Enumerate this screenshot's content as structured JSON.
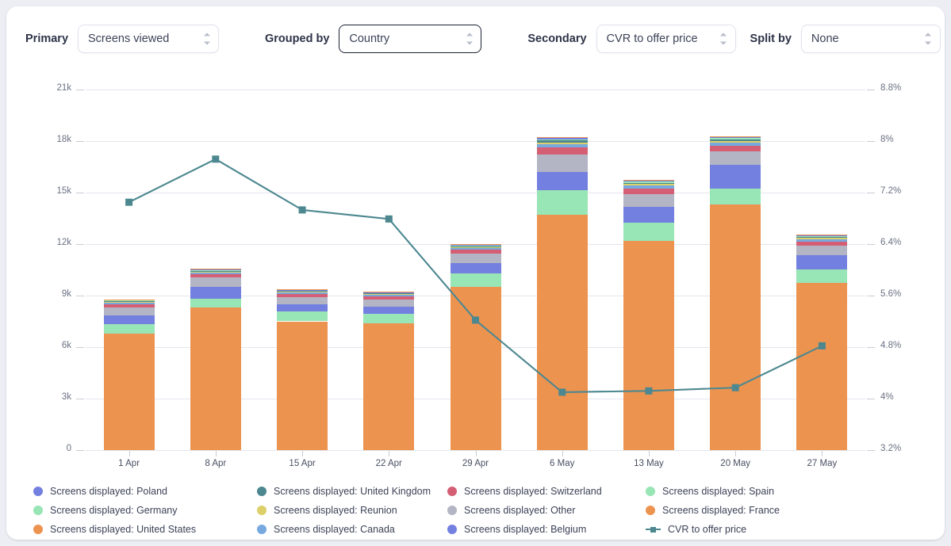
{
  "controls": [
    {
      "label": "Primary",
      "value": "Screens viewed",
      "focused": false,
      "name": "primary"
    },
    {
      "label": "Grouped by",
      "value": "Country",
      "focused": true,
      "name": "grouped-by"
    },
    {
      "label": "Secondary",
      "value": "CVR to offer price",
      "focused": false,
      "name": "secondary"
    },
    {
      "label": "Split by",
      "value": "None",
      "focused": false,
      "name": "split-by"
    }
  ],
  "chart_data": {
    "type": "bar",
    "title": "",
    "xlabel": "",
    "ylabel": "",
    "categories": [
      "1 Apr",
      "8 Apr",
      "15 Apr",
      "22 Apr",
      "29 Apr",
      "6 May",
      "13 May",
      "20 May",
      "27 May"
    ],
    "left_axis": {
      "ticks": [
        "0",
        "3k",
        "6k",
        "9k",
        "12k",
        "15k",
        "18k",
        "21k"
      ],
      "values": [
        0,
        3000,
        6000,
        9000,
        12000,
        15000,
        18000,
        21000
      ],
      "ylim": [
        0,
        21000
      ]
    },
    "right_axis": {
      "ticks": [
        "3.2%",
        "4%",
        "4.8%",
        "5.6%",
        "6.4%",
        "7.2%",
        "8%",
        "8.8%"
      ],
      "values": [
        3.2,
        4.0,
        4.8,
        5.6,
        6.4,
        7.2,
        8.0,
        8.8
      ],
      "ylim": [
        3.2,
        8.8
      ]
    },
    "grid": true,
    "legend_position": "bottom",
    "stacked": true,
    "series": [
      {
        "name": "Screens displayed: France",
        "color": "#ed9350",
        "values": [
          6800,
          8300,
          7500,
          7400,
          9500,
          13700,
          12200,
          14300,
          9750
        ]
      },
      {
        "name": "Screens displayed: Spain",
        "color": "#98e5b5",
        "values": [
          520,
          520,
          560,
          520,
          800,
          1450,
          1050,
          950,
          780
        ]
      },
      {
        "name": "Screens displayed: Belgium",
        "color": "#7380e0",
        "values": [
          540,
          700,
          420,
          430,
          600,
          1050,
          900,
          1350,
          820
        ]
      },
      {
        "name": "Screens displayed: Other",
        "color": "#b3b5c4",
        "values": [
          450,
          530,
          430,
          420,
          540,
          1000,
          760,
          800,
          560
        ]
      },
      {
        "name": "Screens displayed: Switzerland",
        "color": "#d45f74",
        "values": [
          180,
          180,
          170,
          170,
          220,
          420,
          330,
          340,
          250
        ]
      },
      {
        "name": "Screens displayed: Canada",
        "color": "#77a9de",
        "values": [
          110,
          120,
          110,
          110,
          120,
          200,
          160,
          170,
          130
        ]
      },
      {
        "name": "Screens displayed: Reunion",
        "color": "#ddd06a",
        "values": [
          45,
          50,
          45,
          45,
          50,
          110,
          90,
          95,
          60
        ]
      },
      {
        "name": "Screens displayed: United Kingdom",
        "color": "#4d8890",
        "values": [
          40,
          45,
          40,
          40,
          45,
          95,
          75,
          85,
          55
        ]
      },
      {
        "name": "Screens displayed: Germany",
        "color": "#98e5b5",
        "values": [
          35,
          40,
          35,
          35,
          40,
          85,
          65,
          75,
          50
        ]
      },
      {
        "name": "Screens displayed: Poland",
        "color": "#7380e0",
        "values": [
          30,
          35,
          30,
          30,
          35,
          75,
          55,
          65,
          45
        ]
      },
      {
        "name": "Screens displayed: United States",
        "color": "#ed9350",
        "values": [
          25,
          30,
          25,
          25,
          30,
          65,
          45,
          55,
          40
        ]
      }
    ],
    "line_series": {
      "name": "CVR to offer price",
      "color": "#4d8890",
      "values": [
        7.05,
        7.72,
        6.93,
        6.79,
        5.22,
        4.1,
        4.12,
        4.17,
        4.82
      ]
    }
  },
  "legend": [
    {
      "label": "Screens displayed: Poland",
      "color": "#7380e0",
      "marker": "dot",
      "name": "legend-poland"
    },
    {
      "label": "Screens displayed: Germany",
      "color": "#98e5b5",
      "marker": "dot",
      "name": "legend-germany"
    },
    {
      "label": "Screens displayed: United States",
      "color": "#ed9350",
      "marker": "dot",
      "name": "legend-united-states"
    },
    {
      "label": "Screens displayed: United Kingdom",
      "color": "#4d8890",
      "marker": "dot",
      "name": "legend-united-kingdom"
    },
    {
      "label": "Screens displayed: Reunion",
      "color": "#ddd06a",
      "marker": "dot",
      "name": "legend-reunion"
    },
    {
      "label": "Screens displayed: Canada",
      "color": "#77a9de",
      "marker": "dot",
      "name": "legend-canada"
    },
    {
      "label": "Screens displayed: Switzerland",
      "color": "#d45f74",
      "marker": "dot",
      "name": "legend-switzerland"
    },
    {
      "label": "Screens displayed: Other",
      "color": "#b3b5c4",
      "marker": "dot",
      "name": "legend-other"
    },
    {
      "label": "Screens displayed: Belgium",
      "color": "#7380e0",
      "marker": "dot",
      "name": "legend-belgium"
    },
    {
      "label": "Screens displayed: Spain",
      "color": "#98e5b5",
      "marker": "dot",
      "name": "legend-spain"
    },
    {
      "label": "Screens displayed: France",
      "color": "#ed9350",
      "marker": "dot",
      "name": "legend-france"
    },
    {
      "label": "CVR to offer price",
      "color": "#4d8890",
      "marker": "line",
      "name": "legend-cvr-to-offer-price"
    }
  ]
}
